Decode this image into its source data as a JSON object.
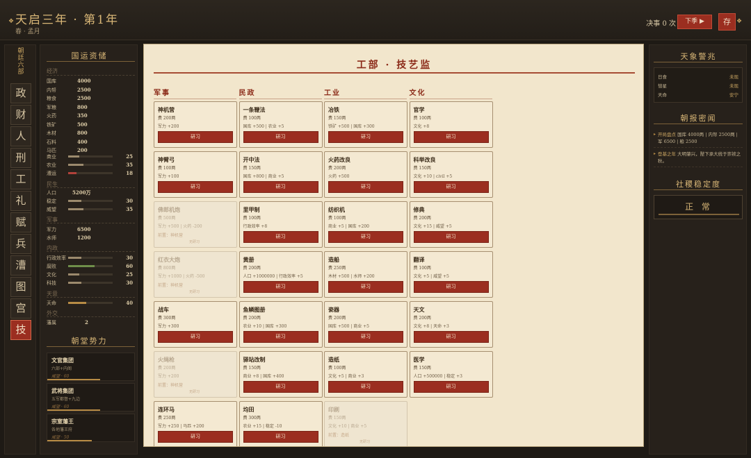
{
  "header": {
    "title": "天启三年 · 第1年",
    "subtitle": "春 · 孟月",
    "decisions": "决事 0 次",
    "next_label": "下季 ▶",
    "save_label": "存"
  },
  "nav": {
    "heading": [
      "朝",
      "廷",
      "六",
      "部"
    ],
    "items": [
      "政",
      "财",
      "人",
      "刑",
      "工",
      "礼",
      "赋",
      "兵",
      "漕",
      "图",
      "宫",
      "技"
    ],
    "active": "技"
  },
  "left": {
    "title": "国运资储",
    "groups": {
      "economy": "经济",
      "people": "民生",
      "military": "军事",
      "internal": "内政",
      "heaven": "天意",
      "diplomacy": "外交"
    },
    "economy": [
      {
        "label": "国库",
        "value": "4000"
      },
      {
        "label": "内帑",
        "value": "2500"
      },
      {
        "label": "粮食",
        "value": "2500"
      },
      {
        "label": "军粮",
        "value": "800"
      },
      {
        "label": "火药",
        "value": "350"
      },
      {
        "label": "铁矿",
        "value": "500"
      },
      {
        "label": "木材",
        "value": "800"
      },
      {
        "label": "石料",
        "value": "400"
      },
      {
        "label": "马匹",
        "value": "200"
      }
    ],
    "economy_bars": [
      {
        "label": "商业",
        "value": "25",
        "level": 0.25
      },
      {
        "label": "农业",
        "value": "35",
        "level": 0.35
      },
      {
        "label": "漕运",
        "value": "18",
        "level": 0.18
      }
    ],
    "people": {
      "pop_label": "人口",
      "pop_value": "5200万"
    },
    "people_bars": [
      {
        "label": "稳定",
        "value": "30",
        "level": 0.3
      },
      {
        "label": "威望",
        "value": "35",
        "level": 0.35
      }
    ],
    "military": [
      {
        "label": "军力",
        "value": "6500"
      },
      {
        "label": "水师",
        "value": "1200"
      }
    ],
    "internal_bars": [
      {
        "label": "行政效率",
        "value": "30",
        "level": 0.3
      },
      {
        "label": "腐败",
        "value": "60",
        "level": 0.6
      },
      {
        "label": "文化",
        "value": "25",
        "level": 0.25
      },
      {
        "label": "科技",
        "value": "30",
        "level": 0.3
      }
    ],
    "heaven_bars": [
      {
        "label": "天命",
        "value": "40",
        "level": 0.4
      }
    ],
    "diplomacy": {
      "label": "藩属",
      "value": "2"
    },
    "factions_title": "朝堂势力",
    "factions": [
      {
        "name": "文官集团",
        "desc": "六部+内阁",
        "prestige": "威望 · 60",
        "level": 0.6
      },
      {
        "name": "武将集团",
        "desc": "五军都督+九边",
        "prestige": "威望 · 60",
        "level": 0.6
      },
      {
        "name": "宗室藩王",
        "desc": "各地藩王府",
        "prestige": "威望 · 50",
        "level": 0.5
      }
    ]
  },
  "main": {
    "title": "工部 · 技艺监",
    "research_label": "研习",
    "researched_label": "无研习",
    "columns": [
      {
        "name": "军事",
        "techs": [
          {
            "name": "神机营",
            "cost": "费 200两",
            "effect": "军力 +200",
            "locked": false
          },
          {
            "name": "神臂弓",
            "cost": "费 100两",
            "effect": "军力 +100",
            "locked": false
          },
          {
            "name": "佛郎机炮",
            "cost": "费 500两",
            "effect": "军力 +500 | 火药 -200",
            "locked": true,
            "prereq": "前置：神机营"
          },
          {
            "name": "红衣大炮",
            "cost": "费 800两",
            "effect": "军力 +1000 | 火药 -500",
            "locked": true,
            "prereq": "前置：神机营"
          },
          {
            "name": "战车",
            "cost": "费 300两",
            "effect": "军力 +300",
            "locked": false
          },
          {
            "name": "火绳枪",
            "cost": "费 200两",
            "effect": "军力 +200",
            "locked": true,
            "prereq": "前置：神机营"
          },
          {
            "name": "连环马",
            "cost": "费 250两",
            "effect": "军力 +250 | 马匹 +200",
            "locked": false
          }
        ]
      },
      {
        "name": "民政",
        "techs": [
          {
            "name": "一条鞭法",
            "cost": "费 100两",
            "effect": "国库 +500 | 农业 +5",
            "locked": false
          },
          {
            "name": "开中法",
            "cost": "费 150两",
            "effect": "国库 +800 | 商业 +5",
            "locked": false
          },
          {
            "name": "里甲制",
            "cost": "费 100两",
            "effect": "行政效率 +8",
            "locked": false
          },
          {
            "name": "黄册",
            "cost": "费 200两",
            "effect": "人口 +1000000 | 行政效率 +5",
            "locked": false
          },
          {
            "name": "鱼鳞图册",
            "cost": "费 200两",
            "effect": "农业 +10 | 国库 +300",
            "locked": false
          },
          {
            "name": "驿站改制",
            "cost": "费 150两",
            "effect": "商业 +8 | 国库 +400",
            "locked": false
          },
          {
            "name": "均田",
            "cost": "费 300两",
            "effect": "农业 +15 | 稳定 -10",
            "locked": false
          }
        ]
      },
      {
        "name": "工业",
        "techs": [
          {
            "name": "冶铁",
            "cost": "费 150两",
            "effect": "铁矿 +500 | 国库 +300",
            "locked": false
          },
          {
            "name": "火药改良",
            "cost": "费 200两",
            "effect": "火药 +500",
            "locked": false
          },
          {
            "name": "纺织机",
            "cost": "费 100两",
            "effect": "商业 +5 | 国库 +200",
            "locked": false
          },
          {
            "name": "造船",
            "cost": "费 250两",
            "effect": "木材 +500 | 水师 +200",
            "locked": false
          },
          {
            "name": "瓷器",
            "cost": "费 200两",
            "effect": "国库 +500 | 商业 +5",
            "locked": false
          },
          {
            "name": "造纸",
            "cost": "费 100两",
            "effect": "文化 +5 | 商业 +3",
            "locked": false
          },
          {
            "name": "印刷",
            "cost": "费 150两",
            "effect": "文化 +10 | 商业 +5",
            "locked": true,
            "prereq": "前置：造纸"
          }
        ]
      },
      {
        "name": "文化",
        "techs": [
          {
            "name": "官学",
            "cost": "费 100两",
            "effect": "文化 +8",
            "locked": false
          },
          {
            "name": "科举改良",
            "cost": "费 150两",
            "effect": "文化 +10 | civil +5",
            "locked": false
          },
          {
            "name": "修典",
            "cost": "费 200两",
            "effect": "文化 +15 | 威望 +5",
            "locked": false
          },
          {
            "name": "翻译",
            "cost": "费 100两",
            "effect": "文化 +5 | 威望 +5",
            "locked": false
          },
          {
            "name": "天文",
            "cost": "费 200两",
            "effect": "文化 +8 | 天命 +3",
            "locked": false
          },
          {
            "name": "医学",
            "cost": "费 150两",
            "effect": "人口 +500000 | 稳定 +3",
            "locked": false
          }
        ]
      }
    ]
  },
  "right": {
    "omens_title": "天象警兆",
    "omens": [
      {
        "label": "日食",
        "value": "未现"
      },
      {
        "label": "彗星",
        "value": "未现"
      },
      {
        "label": "天命",
        "value": "安宁"
      }
    ],
    "news_title": "朝报密闻",
    "news": [
      {
        "head": "开局盘点",
        "text": "国库 4000两 | 内帑 2500两 | 军 6500 | 粮 2500"
      },
      {
        "head": "登基之年",
        "text": "大明肇兴，陛下承大统于崇祯之秋。"
      }
    ],
    "stability_title": "社稷稳定度",
    "stability_value": "正 常"
  },
  "colors": {
    "accent_red": "#9b2e20",
    "gold": "#d9b777",
    "parchment": "#f2e6cc"
  }
}
